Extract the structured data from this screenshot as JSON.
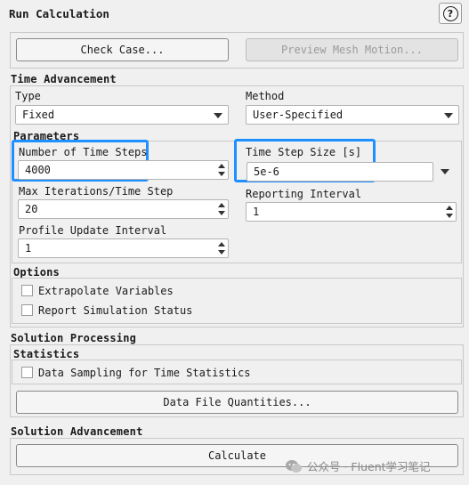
{
  "panel": {
    "title": "Run Calculation",
    "help_label": "?"
  },
  "top_buttons": {
    "check_case": "Check Case...",
    "preview_mesh_motion": "Preview Mesh Motion..."
  },
  "time_advancement": {
    "title": "Time Advancement",
    "type_label": "Type",
    "type_value": "Fixed",
    "method_label": "Method",
    "method_value": "User-Specified"
  },
  "parameters": {
    "title": "Parameters",
    "num_time_steps_label": "Number of Time Steps",
    "num_time_steps_value": "4000",
    "time_step_size_label": "Time Step Size [s]",
    "time_step_size_value": "5e-6",
    "max_iterations_label": "Max Iterations/Time Step",
    "max_iterations_value": "20",
    "reporting_interval_label": "Reporting Interval",
    "reporting_interval_value": "1",
    "profile_update_label": "Profile Update Interval",
    "profile_update_value": "1"
  },
  "options": {
    "title": "Options",
    "extrapolate_label": "Extrapolate Variables",
    "extrapolate_checked": false,
    "report_status_label": "Report Simulation Status",
    "report_status_checked": false
  },
  "solution_processing": {
    "title": "Solution Processing",
    "statistics_title": "Statistics",
    "data_sampling_label": "Data Sampling for Time Statistics",
    "data_sampling_checked": false,
    "data_file_quantities": "Data File Quantities..."
  },
  "solution_advancement": {
    "title": "Solution Advancement",
    "calculate": "Calculate"
  },
  "watermark": {
    "text": "公众号 · Fluent学习笔记"
  },
  "colors": {
    "highlight": "#1e90ff",
    "background": "#f0f0f0"
  }
}
